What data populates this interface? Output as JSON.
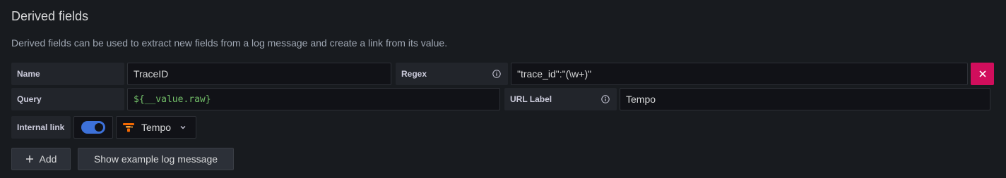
{
  "section": {
    "title": "Derived fields",
    "description": "Derived fields can be used to extract new fields from a log message and create a link from its value."
  },
  "field": {
    "name_label": "Name",
    "name_value": "TraceID",
    "regex_label": "Regex",
    "regex_value": "\"trace_id\":\"(\\w+)\"",
    "query_label": "Query",
    "query_value": "${__value.raw}",
    "url_label_label": "URL Label",
    "url_label_value": "Tempo",
    "internal_link_label": "Internal link",
    "internal_link_enabled": true,
    "datasource": "Tempo"
  },
  "actions": {
    "add_label": "Add",
    "show_example_label": "Show example log message"
  },
  "colors": {
    "delete_button": "#d10e5c",
    "toggle_on": "#3d71d9",
    "query_text": "#73bf69"
  },
  "icons": {
    "delete": "close-icon",
    "info": "info-icon",
    "add": "plus-icon",
    "datasource": "tempo-logo",
    "dropdown": "chevron-down-icon"
  }
}
